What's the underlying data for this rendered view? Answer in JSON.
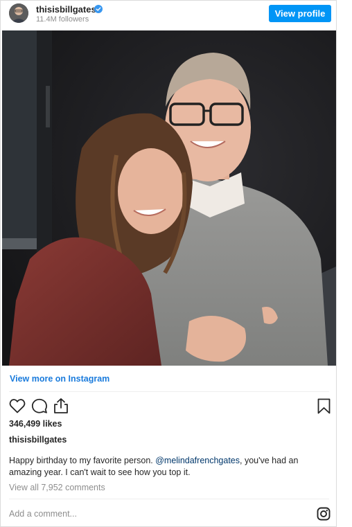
{
  "post": {
    "username": "thisisbillgates",
    "followers": "11.4M followers",
    "view_profile_label": "View profile",
    "view_more_label": "View more on Instagram",
    "likes": "346,499 likes",
    "caption_author": "thisisbillgates",
    "caption_before": "Happy birthday to my favorite person. ",
    "caption_mention": "@melindafrenchgates",
    "caption_after": ", you've had an amazing year. I can't wait to see how you top it.",
    "comments_link": "View all 7,952 comments",
    "add_comment_placeholder": "Add a comment..."
  },
  "icons": {
    "verified": "verified-badge-icon",
    "like": "heart-icon",
    "comment": "comment-bubble-icon",
    "share": "share-icon",
    "save": "bookmark-icon",
    "instagram": "instagram-logo-icon"
  },
  "colors": {
    "accent": "#0095f6",
    "link": "#1a7bdc",
    "mention": "#00376b",
    "muted": "#8e8e8e"
  }
}
